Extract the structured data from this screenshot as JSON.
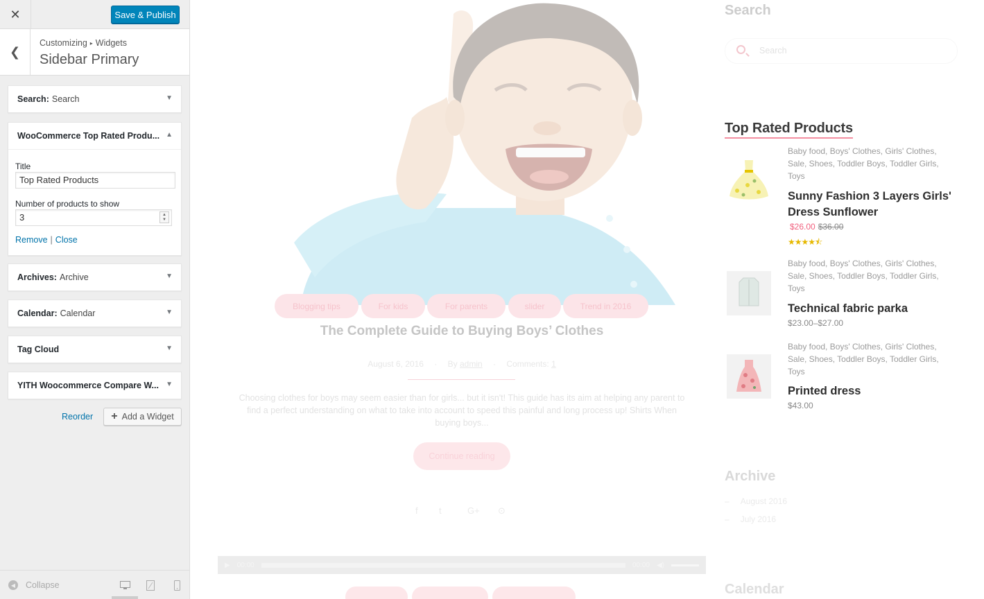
{
  "topbar": {
    "close_icon": "close-icon",
    "publish_label": "Save & Publish",
    "accent_color": "#0085ba"
  },
  "section": {
    "breadcrumb_root": "Customizing",
    "breadcrumb_child": "Widgets",
    "title": "Sidebar Primary"
  },
  "widgets": [
    {
      "name": "Search:",
      "subtitle": "Search"
    },
    {
      "name": "WooCommerce Top Rated Produ...",
      "subtitle": ""
    },
    {
      "name": "Archives:",
      "subtitle": "Archive"
    },
    {
      "name": "Calendar:",
      "subtitle": "Calendar"
    },
    {
      "name": "Tag Cloud",
      "subtitle": ""
    },
    {
      "name": "YITH Woocommerce Compare W...",
      "subtitle": ""
    }
  ],
  "widget_form": {
    "title_label": "Title",
    "title_value": "Top Rated Products",
    "number_label": "Number of products to show",
    "number_value": "3",
    "remove_label": "Remove",
    "separator": "|",
    "close_label": "Close"
  },
  "panel_actions": {
    "reorder_label": "Reorder",
    "add_widget_label": "Add a Widget"
  },
  "footer": {
    "collapse_label": "Collapse"
  },
  "preview": {
    "categories": [
      "Blogging tips",
      "For kids",
      "For parents",
      "slider",
      "Trend in 2016"
    ],
    "post_title": "The Complete Guide to Buying Boys’ Clothes",
    "post_date": "August 6, 2016",
    "post_by": "By",
    "post_author": "admin",
    "post_comments_label": "Comments:",
    "post_comments_count": "1",
    "excerpt": "Choosing clothes for boys may seem easier than for girls... but it isn't! This guide has its aim at helping any parent to find a perfect understanding on what to take into account to speed this painful and long process up! Shirts When buying boys...",
    "continue_label": "Continue reading",
    "player_time_start": "00:00",
    "player_time_end": "00:00"
  },
  "sidebar": {
    "search_title": "Search",
    "search_placeholder": "Search",
    "top_rated_title": "Top Rated Products",
    "products": [
      {
        "categories": "Baby food, Boys' Clothes, Girls' Clothes, Sale, Shoes, Toddler Boys, Toddler Girls, Toys",
        "name": "Sunny Fashion 3 Layers Girls' Dress Sunflower",
        "price_sale": "$26.00",
        "price_old": "$36.00",
        "rating": 4.5
      },
      {
        "categories": "Baby food, Boys' Clothes, Girls' Clothes, Sale, Shoes, Toddler Boys, Toddler Girls, Toys",
        "name": "Technical fabric parka",
        "price": "$23.00–$27.00"
      },
      {
        "categories": "Baby food, Boys' Clothes, Girls' Clothes, Sale, Shoes, Toddler Boys, Toddler Girls, Toys",
        "name": "Printed dress",
        "price": "$43.00"
      }
    ],
    "archive_title": "Archive",
    "archive_items": [
      "August 2016",
      "July 2016"
    ],
    "calendar_title": "Calendar"
  }
}
